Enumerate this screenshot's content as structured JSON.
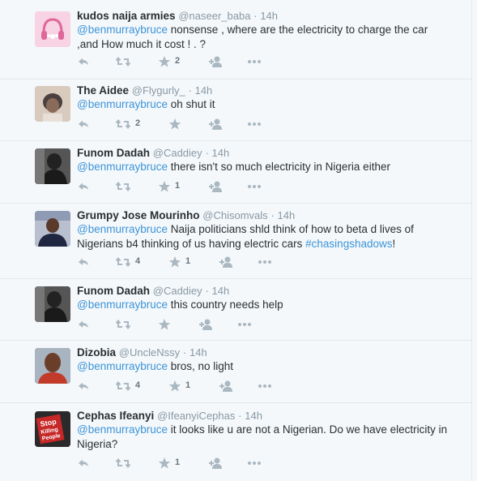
{
  "tweets": [
    {
      "fullname": "kudos naija armies",
      "username": "@naseer_baba",
      "time": "14h",
      "mention": "@benmurraybruce",
      "text": " nonsense , where are  the electricity to charge the car ,and How much it cost ! . ?",
      "retweets": "",
      "favorites": "2",
      "avatar_color": "#f6c6dc"
    },
    {
      "fullname": "The Aidee",
      "username": "@Flygurly_",
      "time": "14h",
      "mention": "@benmurraybruce",
      "text": " oh shut it",
      "retweets": "2",
      "favorites": "",
      "avatar_color": "#c9b9a8"
    },
    {
      "fullname": "Funom Dadah",
      "username": "@Caddiey",
      "time": "14h",
      "mention": "@benmurraybruce",
      "text": " there isn't so much electricity in Nigeria either",
      "retweets": "",
      "favorites": "1",
      "avatar_color": "#3a3a3a"
    },
    {
      "fullname": "Grumpy Jose Mourinho",
      "username": "@Chisomvals",
      "time": "14h",
      "mention": "@benmurraybruce",
      "text": " Naija politicians shld think of how to beta d lives of Nigerians b4 thinking of us having electric cars ",
      "hashtag": "#chasingshadows",
      "text_after": "!",
      "retweets": "4",
      "favorites": "1",
      "avatar_color": "#2c3550"
    },
    {
      "fullname": "Funom Dadah",
      "username": "@Caddiey",
      "time": "14h",
      "mention": "@benmurraybruce",
      "text": " this country needs help",
      "retweets": "",
      "favorites": "",
      "avatar_color": "#3a3a3a"
    },
    {
      "fullname": "Dizobia",
      "username": "@UncleNssy",
      "time": "14h",
      "mention": "@benmurraybruce",
      "text": " bros, no light",
      "retweets": "4",
      "favorites": "1",
      "avatar_color": "#7a4a36"
    },
    {
      "fullname": "Cephas Ifeanyi",
      "username": "@IfeanyiCephas",
      "time": "14h",
      "mention": "@benmurraybruce",
      "text": " it looks like u are not a Nigerian. Do we have electricity in Nigeria?",
      "retweets": "",
      "favorites": "1",
      "avatar_color": "#222222",
      "avatar_text": [
        "Stop",
        "Killing",
        "People"
      ]
    }
  ],
  "time_separator": "·",
  "colors": {
    "link": "#3b94d9",
    "name": "#292f33",
    "muted": "#8899a6",
    "action": "#aab8c2",
    "background": "#f5f8fa"
  },
  "icons": [
    "reply-icon",
    "retweet-icon",
    "favorite-icon",
    "follow-icon",
    "more-icon"
  ]
}
